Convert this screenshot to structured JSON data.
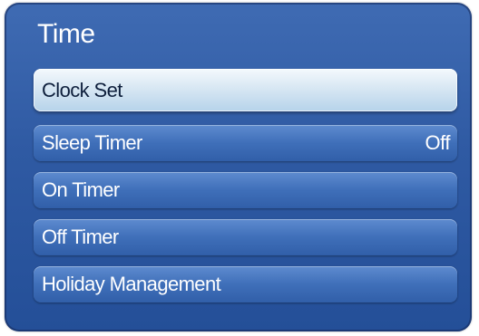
{
  "panel": {
    "title": "Time",
    "items": [
      {
        "label": "Clock Set",
        "value": "",
        "selected": true
      },
      {
        "label": "Sleep Timer",
        "value": "Off",
        "selected": false
      },
      {
        "label": "On Timer",
        "value": "",
        "selected": false
      },
      {
        "label": "Off Timer",
        "value": "",
        "selected": false
      },
      {
        "label": "Holiday Management",
        "value": "",
        "selected": false
      }
    ]
  }
}
